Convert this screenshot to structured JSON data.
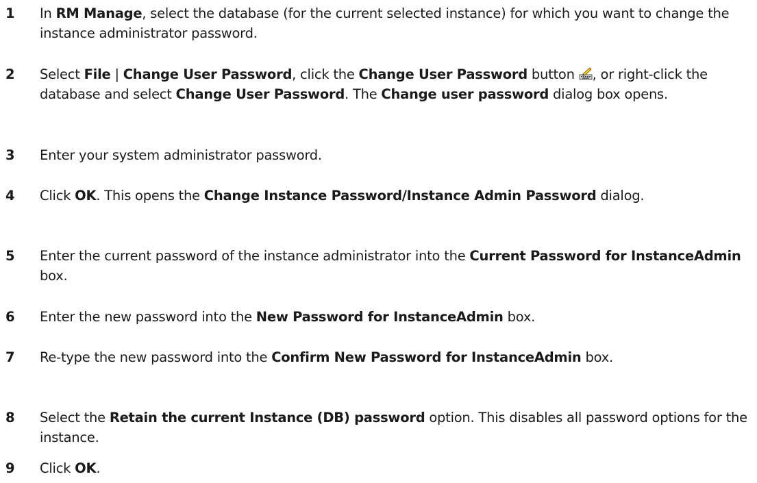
{
  "steps": [
    {
      "number": "1",
      "parts": [
        {
          "t": "In ",
          "b": false
        },
        {
          "t": "RM Manage",
          "b": true
        },
        {
          "t": ", select the database (for the current selected instance) for which you want to change the instance administrator password.",
          "b": false
        }
      ]
    },
    {
      "number": "2",
      "parts": [
        {
          "t": "Select ",
          "b": false
        },
        {
          "t": "File",
          "b": true
        },
        {
          "t": " | ",
          "b": false
        },
        {
          "t": "Change User Password",
          "b": true
        },
        {
          "t": ", click the ",
          "b": false
        },
        {
          "t": "Change User Password",
          "b": true
        },
        {
          "t": " button ",
          "b": false
        },
        {
          "icon": "change-password-icon"
        },
        {
          "t": ", or right-click the database and select ",
          "b": false
        },
        {
          "t": "Change User Password",
          "b": true
        },
        {
          "t": ". The ",
          "b": false
        },
        {
          "t": "Change user password",
          "b": true
        },
        {
          "t": " dialog box opens.",
          "b": false
        }
      ]
    },
    {
      "number": "3",
      "parts": [
        {
          "t": "Enter your system administrator password.",
          "b": false
        }
      ]
    },
    {
      "number": "4",
      "parts": [
        {
          "t": "Click ",
          "b": false
        },
        {
          "t": "OK",
          "b": true
        },
        {
          "t": ". This opens the ",
          "b": false
        },
        {
          "t": "Change Instance Password/Instance Admin Password",
          "b": true
        },
        {
          "t": " dialog.",
          "b": false
        }
      ]
    },
    {
      "number": "5",
      "parts": [
        {
          "t": "Enter the current password of the instance administrator into the ",
          "b": false
        },
        {
          "t": "Current Password for InstanceAdmin",
          "b": true
        },
        {
          "t": " box.",
          "b": false
        }
      ]
    },
    {
      "number": "6",
      "parts": [
        {
          "t": "Enter the new password into the ",
          "b": false
        },
        {
          "t": "New Password for InstanceAdmin",
          "b": true
        },
        {
          "t": " box.",
          "b": false
        }
      ]
    },
    {
      "number": "7",
      "parts": [
        {
          "t": "Re-type the new password into the ",
          "b": false
        },
        {
          "t": "Confirm New Password for InstanceAdmin",
          "b": true
        },
        {
          "t": " box.",
          "b": false
        }
      ]
    },
    {
      "number": "8",
      "parts": [
        {
          "t": "Select the ",
          "b": false
        },
        {
          "t": "Retain the current Instance (DB) password",
          "b": true
        },
        {
          "t": " option. This disables all password options for the instance.",
          "b": false
        }
      ]
    },
    {
      "number": "9",
      "parts": [
        {
          "t": "Click ",
          "b": false
        },
        {
          "t": "OK",
          "b": true
        },
        {
          "t": ".",
          "b": false
        }
      ]
    }
  ]
}
